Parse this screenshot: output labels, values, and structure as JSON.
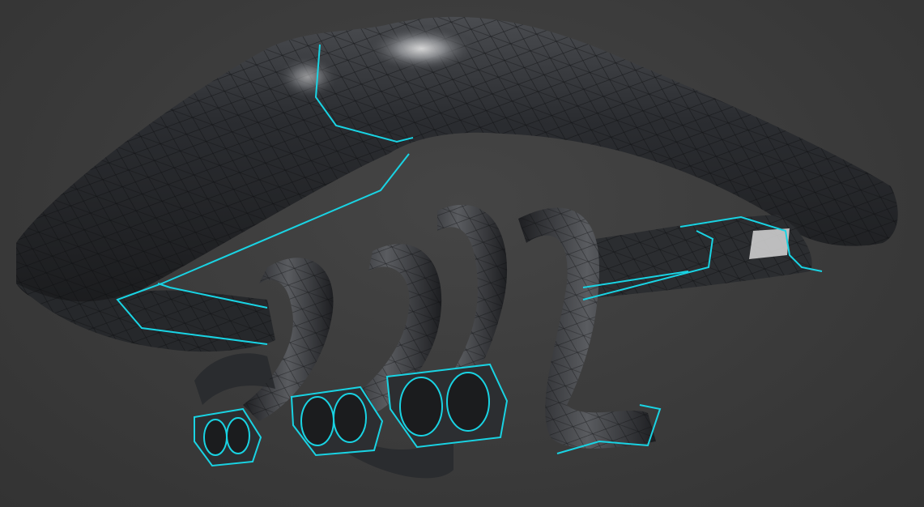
{
  "scene": {
    "description_hidden": "",
    "colors": {
      "background": "#3b3b3b",
      "mesh_dark": "#1f2022",
      "mesh_mid": "#34363a",
      "highlight": "#d9d9d9",
      "wire": "#0e0f10",
      "seam": "#19d3e3"
    },
    "object": "exhaust-manifold-mesh",
    "ports_count": 4
  }
}
